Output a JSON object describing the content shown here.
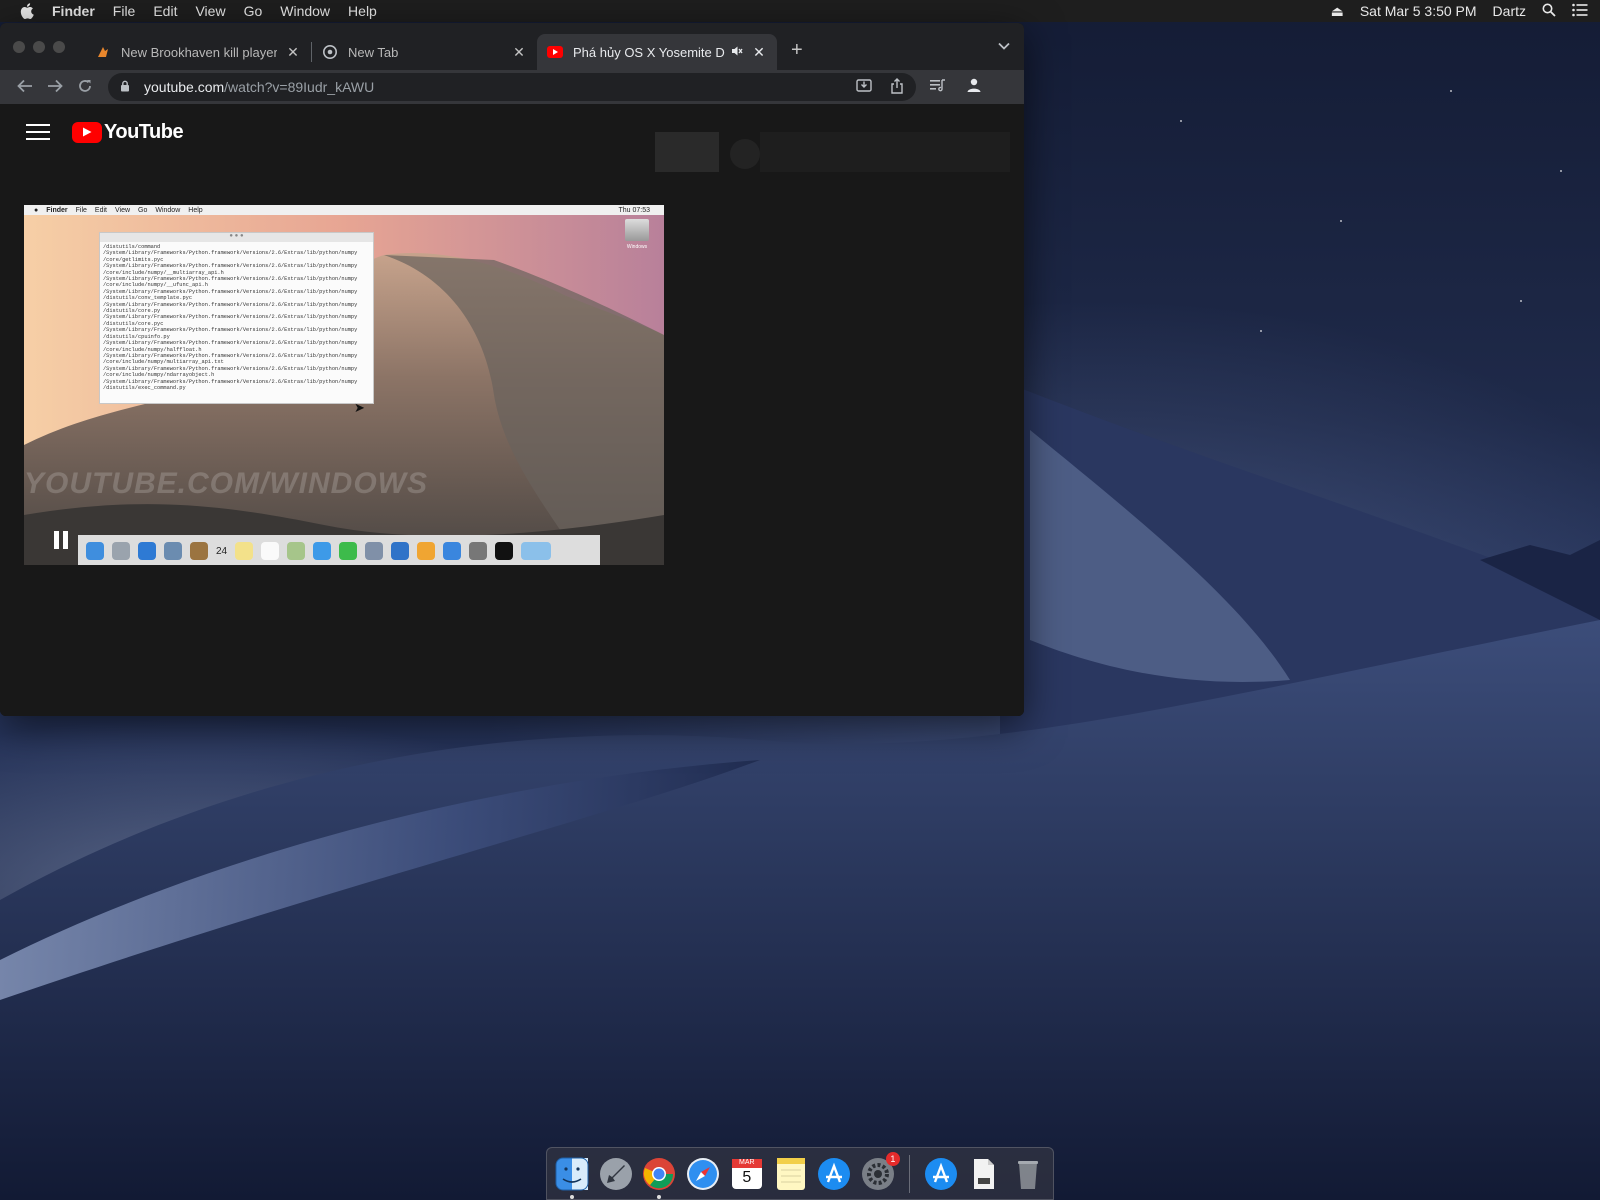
{
  "menubar": {
    "app_name": "Finder",
    "items": [
      "File",
      "Edit",
      "View",
      "Go",
      "Window",
      "Help"
    ],
    "datetime": "Sat Mar 5  3:50 PM",
    "user": "Dartz"
  },
  "browser": {
    "tabs": [
      {
        "title": "New Brookhaven kill player / F",
        "icon": "flame-icon"
      },
      {
        "title": "New Tab",
        "icon": "chrome-icon"
      },
      {
        "title": "Phá hủy OS X Yosemite DF",
        "icon": "youtube-icon"
      }
    ],
    "url_host": "youtube.com",
    "url_path": "/watch?v=89Iudr_kAWU"
  },
  "youtube": {
    "logo_text": "YouTube"
  },
  "video": {
    "menubar": {
      "app": "Finder",
      "items": [
        "File",
        "Edit",
        "View",
        "Go",
        "Window",
        "Help"
      ],
      "clock": "Thu 07:53"
    },
    "terminal_lines": "/distutils/command\n/System/Library/Frameworks/Python.framework/Versions/2.6/Extras/lib/python/numpy\n/core/getlimits.pyc\n/System/Library/Frameworks/Python.framework/Versions/2.6/Extras/lib/python/numpy\n/core/include/numpy/__multiarray_api.h\n/System/Library/Frameworks/Python.framework/Versions/2.6/Extras/lib/python/numpy\n/core/include/numpy/__ufunc_api.h\n/System/Library/Frameworks/Python.framework/Versions/2.6/Extras/lib/python/numpy\n/distutils/conv_template.pyc\n/System/Library/Frameworks/Python.framework/Versions/2.6/Extras/lib/python/numpy\n/distutils/core.py\n/System/Library/Frameworks/Python.framework/Versions/2.6/Extras/lib/python/numpy\n/distutils/core.pyc\n/System/Library/Frameworks/Python.framework/Versions/2.6/Extras/lib/python/numpy\n/distutils/cpuinfo.py\n/System/Library/Frameworks/Python.framework/Versions/2.6/Extras/lib/python/numpy\n/core/include/numpy/halffloat.h\n/System/Library/Frameworks/Python.framework/Versions/2.6/Extras/lib/python/numpy\n/core/include/numpy/multiarray_api.txt\n/System/Library/Frameworks/Python.framework/Versions/2.6/Extras/lib/python/numpy\n/core/include/numpy/ndarrayobject.h\n/System/Library/Frameworks/Python.framework/Versions/2.6/Extras/lib/python/numpy\n/distutils/exec_command.py",
    "hdd_label": "Windows",
    "watermark": "YOUTUBE.COM/WINDOWS",
    "dock_calendar": "24"
  },
  "dock": {
    "calendar_month": "MAR",
    "calendar_day": "5",
    "sysprefs_badge": "1"
  },
  "colors": {
    "youtube_red": "#ff0000",
    "chrome_dark": "#202124",
    "badge_red": "#e52b2b"
  }
}
